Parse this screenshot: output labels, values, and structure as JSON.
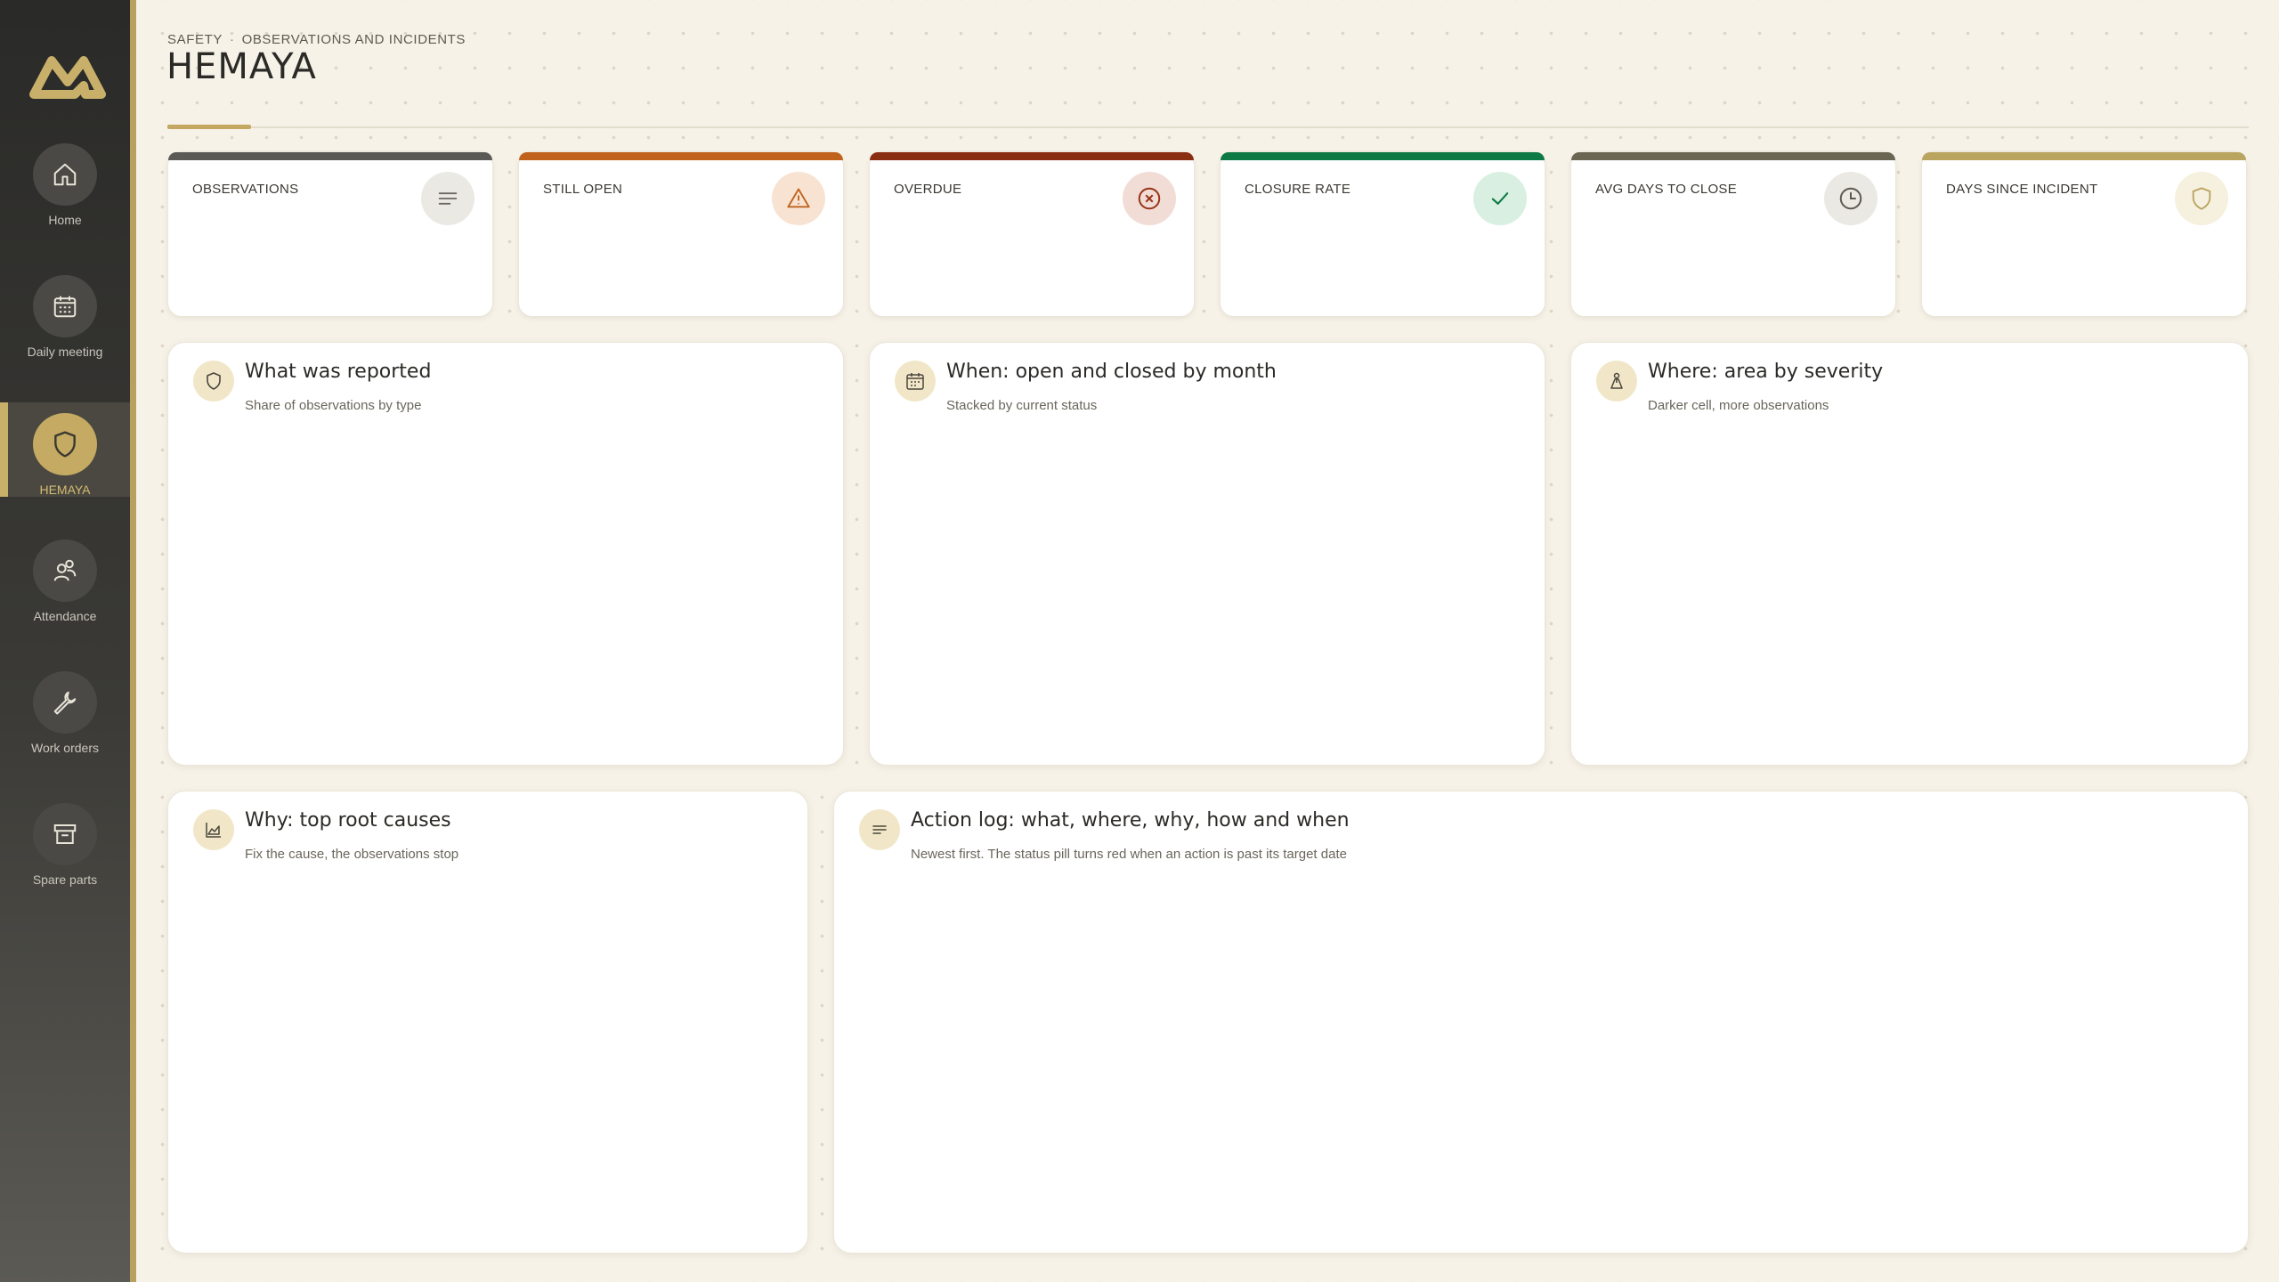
{
  "nav": {
    "items": [
      {
        "label": "Home",
        "icon": "home-icon"
      },
      {
        "label": "Daily meeting",
        "icon": "calendar-icon"
      },
      {
        "label": "HEMAYA",
        "icon": "shield-icon",
        "active": true
      },
      {
        "label": "Attendance",
        "icon": "users-icon"
      },
      {
        "label": "Work orders",
        "icon": "wrench-icon"
      },
      {
        "label": "Spare parts",
        "icon": "archive-icon"
      }
    ]
  },
  "header": {
    "breadcrumb_section": "SAFETY",
    "breadcrumb_separator": "·",
    "breadcrumb_page": "OBSERVATIONS AND INCIDENTS",
    "title": "HEMAYA"
  },
  "kpis": [
    {
      "label": "OBSERVATIONS",
      "accent": "#5a5955",
      "icon": "list-icon"
    },
    {
      "label": "STILL OPEN",
      "accent": "#c0621c",
      "icon": "warning-icon"
    },
    {
      "label": "OVERDUE",
      "accent": "#8a2e12",
      "icon": "x-circle-icon"
    },
    {
      "label": "CLOSURE RATE",
      "accent": "#0d7a45",
      "icon": "check-icon"
    },
    {
      "label": "AVG DAYS TO CLOSE",
      "accent": "#6b6654",
      "icon": "clock-icon"
    },
    {
      "label": "DAYS SINCE INCIDENT",
      "accent": "#b9a460",
      "icon": "shield-outline-icon"
    }
  ],
  "panels": {
    "reported": {
      "title": "What was reported",
      "subtitle": "Share of observations by type"
    },
    "when": {
      "title": "When: open and closed by month",
      "subtitle": "Stacked by current status"
    },
    "where": {
      "title": "Where: area by severity",
      "subtitle": "Darker cell, more observations"
    },
    "why": {
      "title": "Why: top root causes",
      "subtitle": "Fix the cause, the observations stop"
    },
    "log": {
      "title": "Action log: what, where, why, how and when",
      "subtitle": "Newest first. The status pill turns red when an action is past its target date"
    }
  }
}
